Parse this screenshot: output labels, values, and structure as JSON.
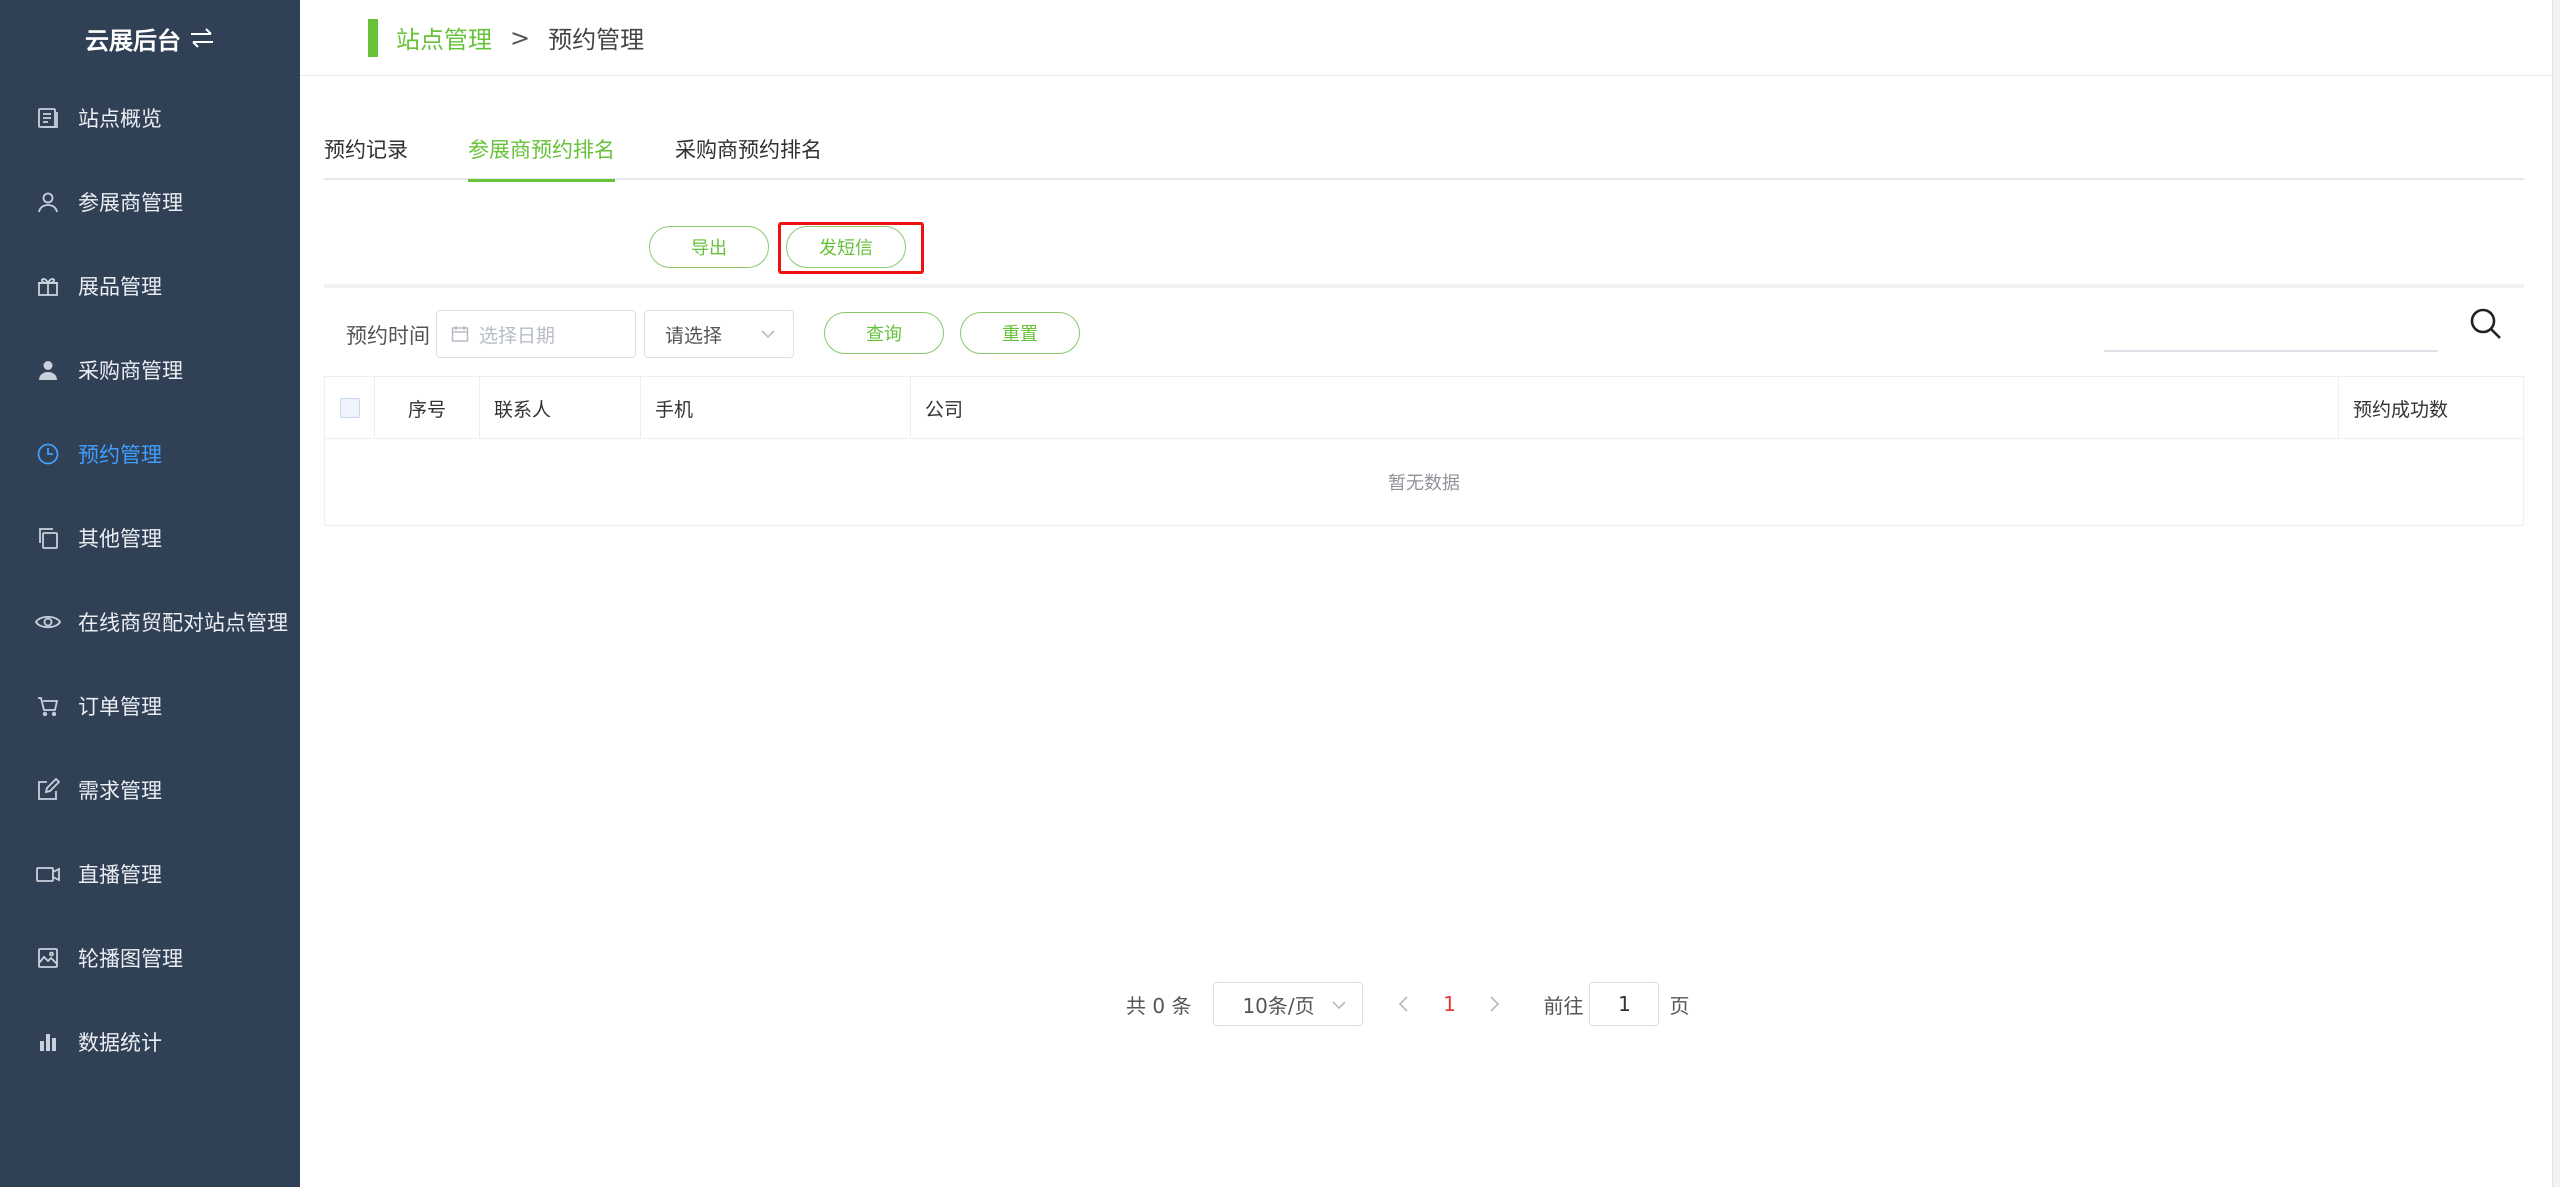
{
  "sidebar": {
    "brand": "云展后台",
    "items": [
      {
        "label": "站点概览",
        "icon": "document-icon"
      },
      {
        "label": "参展商管理",
        "icon": "user-outline-icon"
      },
      {
        "label": "展品管理",
        "icon": "gift-icon"
      },
      {
        "label": "采购商管理",
        "icon": "user-solid-icon"
      },
      {
        "label": "预约管理",
        "icon": "clock-icon",
        "active": true
      },
      {
        "label": "其他管理",
        "icon": "copy-icon"
      },
      {
        "label": "在线商贸配对站点管理",
        "icon": "eye-icon"
      },
      {
        "label": "订单管理",
        "icon": "cart-icon"
      },
      {
        "label": "需求管理",
        "icon": "edit-icon"
      },
      {
        "label": "直播管理",
        "icon": "video-camera-icon"
      },
      {
        "label": "轮播图管理",
        "icon": "picture-icon"
      },
      {
        "label": "数据统计",
        "icon": "bar-chart-icon"
      }
    ]
  },
  "breadcrumb": {
    "parent": "站点管理",
    "separator": ">",
    "current": "预约管理"
  },
  "tabs": [
    {
      "label": "预约记录",
      "active": false
    },
    {
      "label": "参展商预约排名",
      "active": true
    },
    {
      "label": "采购商预约排名",
      "active": false
    }
  ],
  "toolbar": {
    "export_label": "导出",
    "sms_label": "发短信"
  },
  "filters": {
    "time_label": "预约时间",
    "date_placeholder": "选择日期",
    "select_value": "请选择",
    "query_label": "查询",
    "reset_label": "重置"
  },
  "table": {
    "columns": [
      "序号",
      "联系人",
      "手机",
      "公司",
      "预约成功数"
    ],
    "empty_text": "暂无数据"
  },
  "pagination": {
    "total": "共 0 条",
    "page_size": "10条/页",
    "current_page": "1",
    "goto_label": "前往",
    "goto_value": "1",
    "page_unit": "页"
  },
  "colors": {
    "accent": "#67c23a",
    "active_menu": "#409eff",
    "sidebar_bg": "#304156",
    "highlight": "#ee1111",
    "page_number": "#e4393c"
  }
}
